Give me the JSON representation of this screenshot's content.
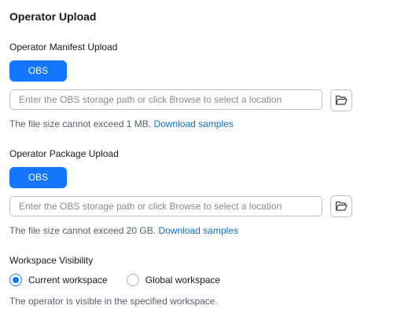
{
  "page": {
    "title": "Operator Upload"
  },
  "manifest": {
    "label": "Operator Manifest Upload",
    "source_button": "OBS",
    "path_placeholder": "Enter the OBS storage path or click Browse to select a location",
    "path_value": "",
    "hint_text": "The file size cannot exceed 1 MB.",
    "hint_link": "Download samples",
    "browse_icon": "folder-open-icon"
  },
  "package": {
    "label": "Operator Package Upload",
    "source_button": "OBS",
    "path_placeholder": "Enter the OBS storage path or click Browse to select a location",
    "path_value": "",
    "hint_text": "The file size cannot exceed 20 GB.",
    "hint_link": "Download samples",
    "browse_icon": "folder-open-icon"
  },
  "visibility": {
    "label": "Workspace Visibility",
    "options": [
      {
        "label": "Current workspace",
        "checked": true
      },
      {
        "label": "Global workspace",
        "checked": false
      }
    ],
    "hint": "The operator is visible in the specified workspace."
  },
  "colors": {
    "accent": "#1476ff",
    "link": "#0a6ed6",
    "hint_text": "#575d6c",
    "border": "#c2c2c2"
  }
}
